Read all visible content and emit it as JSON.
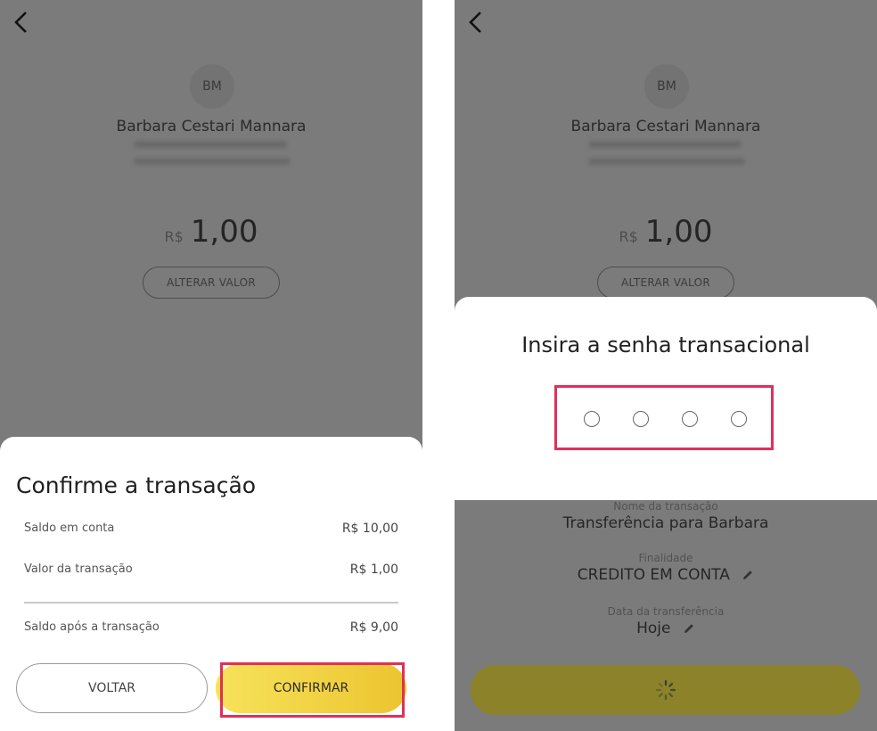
{
  "payee": {
    "initials": "BM",
    "name": "Barbara Cestari Mannara"
  },
  "amount": {
    "currency": "R$",
    "value": "1,00"
  },
  "alter_button_label": "ALTERAR VALOR",
  "confirm_sheet": {
    "title": "Confirme a transação",
    "rows": [
      {
        "label": "Saldo em conta",
        "value": "R$ 10,00"
      },
      {
        "label": "Valor da transação",
        "value": "R$ 1,00"
      },
      {
        "label": "Saldo após a transação",
        "value": "R$ 9,00"
      }
    ],
    "back_label": "VOLTAR",
    "confirm_label": "CONFIRMAR"
  },
  "pin_modal": {
    "title": "Insira a senha transacional",
    "digits": 4
  },
  "details": {
    "transaction_name_label": "Nome da transação",
    "transaction_name": "Transferência para Barbara",
    "purpose_label": "Finalidade",
    "purpose": "CREDITO EM CONTA",
    "date_label": "Data da transferência",
    "date": "Hoje"
  },
  "colors": {
    "accent_yellow": "#f2d443",
    "highlight": "#e0305a",
    "overlay_gray": "#7b7b7b"
  }
}
